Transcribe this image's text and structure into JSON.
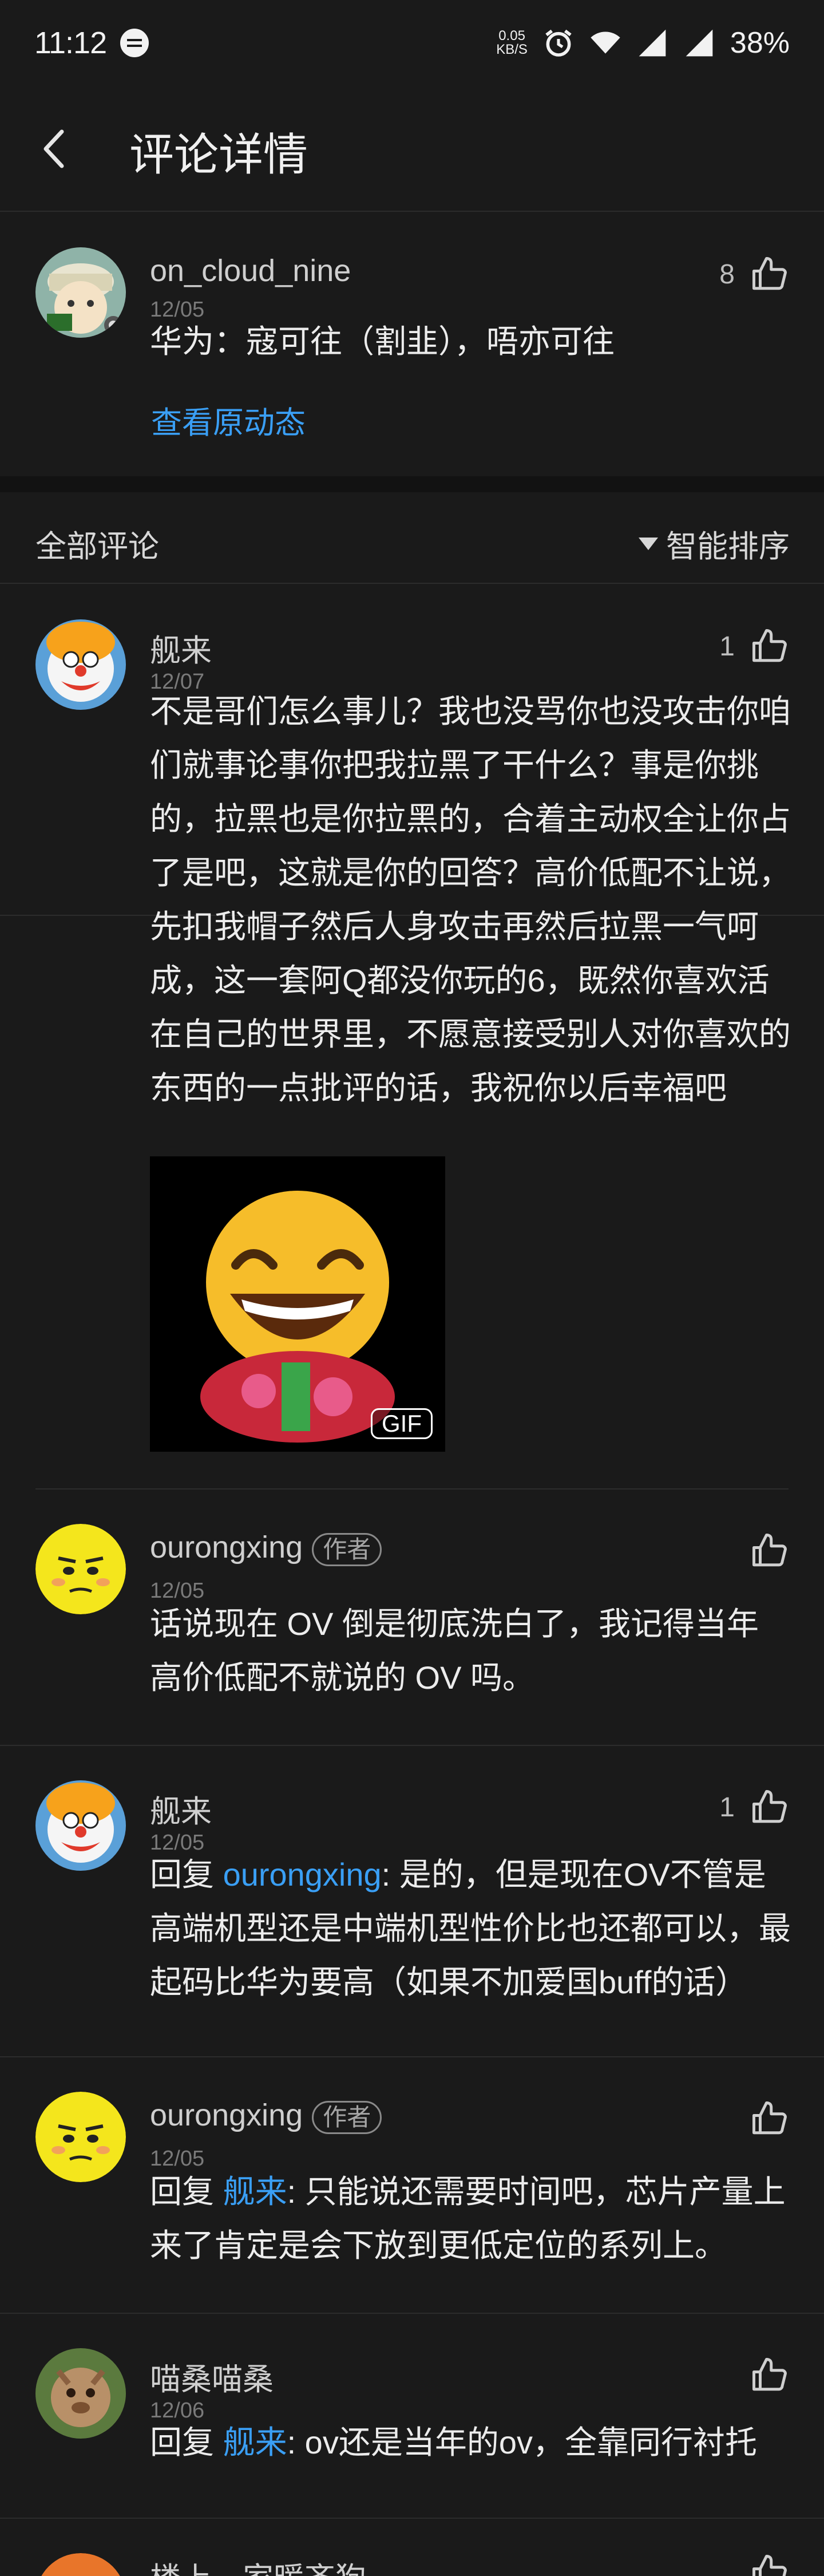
{
  "status_bar": {
    "time": "11:12",
    "speed_top": "0.05",
    "speed_bottom": "KB/S",
    "battery": "38%"
  },
  "header": {
    "title": "评论详情"
  },
  "post": {
    "username": "on_cloud_nine",
    "date": "12/05",
    "text": "华为：寇可往（割韭），唔亦可往",
    "likes": "8",
    "view_original": "查看原动态"
  },
  "comments_section": {
    "title": "全部评论",
    "sort_label": "智能排序"
  },
  "comments": [
    {
      "username": "舰来",
      "date": "12/07",
      "likes": "1",
      "text": "不是哥们怎么事儿？我也没骂你也没攻击你咱们就事论事你把我拉黑了干什么？事是你挑的，拉黑也是你拉黑的，合着主动权全让你占了是吧，这就是你的回答？高价低配不让说，先扣我帽子然后人身攻击再然后拉黑一气呵成，这一套阿Q都没你玩的6，既然你喜欢活在自己的世界里，不愿意接受别人对你喜欢的东西的一点批评的话，我祝你以后幸福吧",
      "gif_badge": "GIF"
    },
    {
      "username": "ourongxing",
      "tag": "作者",
      "date": "12/05",
      "likes": "",
      "text": "话说现在 OV 倒是彻底洗白了，我记得当年高价低配不就说的 OV 吗。"
    },
    {
      "username": "舰来",
      "date": "12/05",
      "likes": "1",
      "reply_prefix": "回复 ",
      "reply_to": "ourongxing",
      "text": ": 是的，但是现在OV不管是高端机型还是中端机型性价比也还都可以，最起码比华为要高（如果不加爱国buff的话）"
    },
    {
      "username": "ourongxing",
      "tag": "作者",
      "date": "12/05",
      "likes": "",
      "reply_prefix": "回复 ",
      "reply_to": "舰来",
      "text": ": 只能说还需要时间吧，芯片产量上来了肯定是会下放到更低定位的系列上。"
    },
    {
      "username": "喵桑喵桑",
      "date": "12/06",
      "likes": "",
      "reply_prefix": "回复 ",
      "reply_to": "舰来",
      "text": ": ov还是当年的ov，全靠同行衬托"
    },
    {
      "username": "楼上…家暖齐狗"
    }
  ],
  "colors": {
    "background": "#1a1a1a",
    "link": "#3a9ff5",
    "text": "#ececec",
    "secondary": "#7a7a7a"
  },
  "icons": [
    "back-arrow-icon",
    "thumbs-up-icon",
    "sort-triangle-icon",
    "message-icon",
    "alarm-icon",
    "wifi-icon",
    "signal-icon"
  ]
}
